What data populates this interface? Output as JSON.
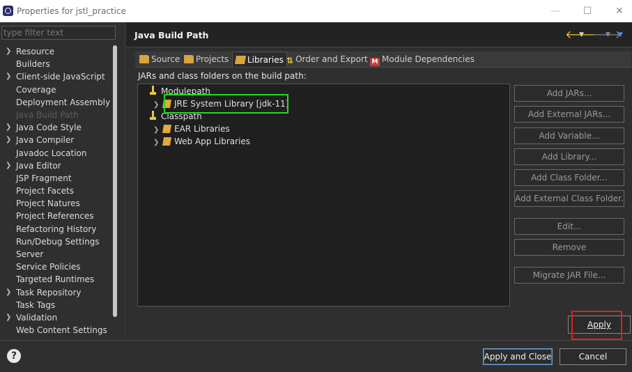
{
  "window": {
    "title": "Properties for jstl_practice",
    "minimize": "—",
    "maximize": "☐",
    "close": "✕"
  },
  "filter": {
    "placeholder": "type filter text"
  },
  "tree": [
    {
      "label": "Resource",
      "expandable": true
    },
    {
      "label": "Builders",
      "expandable": false
    },
    {
      "label": "Client-side JavaScript",
      "expandable": true
    },
    {
      "label": "Coverage",
      "expandable": false
    },
    {
      "label": "Deployment Assembly",
      "expandable": false
    },
    {
      "label": "Java Build Path",
      "expandable": false,
      "selected": true
    },
    {
      "label": "Java Code Style",
      "expandable": true
    },
    {
      "label": "Java Compiler",
      "expandable": true
    },
    {
      "label": "Javadoc Location",
      "expandable": false
    },
    {
      "label": "Java Editor",
      "expandable": true
    },
    {
      "label": "JSP Fragment",
      "expandable": false
    },
    {
      "label": "Project Facets",
      "expandable": false
    },
    {
      "label": "Project Natures",
      "expandable": false
    },
    {
      "label": "Project References",
      "expandable": false
    },
    {
      "label": "Refactoring History",
      "expandable": false
    },
    {
      "label": "Run/Debug Settings",
      "expandable": false
    },
    {
      "label": "Server",
      "expandable": false
    },
    {
      "label": "Service Policies",
      "expandable": false
    },
    {
      "label": "Targeted Runtimes",
      "expandable": false
    },
    {
      "label": "Task Repository",
      "expandable": true
    },
    {
      "label": "Task Tags",
      "expandable": false
    },
    {
      "label": "Validation",
      "expandable": true
    },
    {
      "label": "Web Content Settings",
      "expandable": false
    }
  ],
  "header": {
    "title": "Java Build Path",
    "back_icon": "back-arrow-icon",
    "forward_icon": "forward-arrow-icon"
  },
  "tabs": [
    {
      "label": "Source",
      "icon": "folder-icon"
    },
    {
      "label": "Projects",
      "icon": "folder-icon"
    },
    {
      "label": "Libraries",
      "icon": "library-icon",
      "active": true
    },
    {
      "label": "Order and Export",
      "icon": "order-icon"
    },
    {
      "label": "Module Dependencies",
      "icon": "module-icon",
      "badge": "M"
    }
  ],
  "buildpath": {
    "label": "JARs and class folders on the build path:",
    "nodes": [
      {
        "label": "Modulepath",
        "type": "container"
      },
      {
        "label": "JRE System Library [jdk-11]",
        "type": "library"
      },
      {
        "label": "Classpath",
        "type": "container"
      },
      {
        "label": "EAR Libraries",
        "type": "library"
      },
      {
        "label": "Web App Libraries",
        "type": "library"
      }
    ]
  },
  "side_buttons": [
    "Add JARs...",
    "Add External JARs...",
    "Add Variable...",
    "Add Library...",
    "Add Class Folder...",
    "Add External Class Folder...",
    "Edit...",
    "Remove",
    "Migrate JAR File..."
  ],
  "apply": "Apply",
  "bottom": {
    "help": "?",
    "apply_and_close": "Apply and Close",
    "cancel": "Cancel"
  },
  "colors": {
    "highlight_green": "#22dd22",
    "highlight_red": "#e02020",
    "nav_arrow": "#f0c020"
  }
}
